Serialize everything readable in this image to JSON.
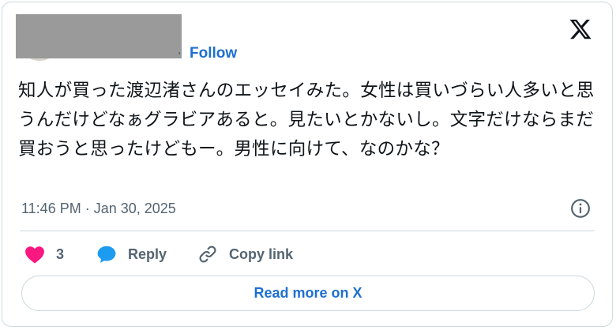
{
  "author": {
    "follow_label": "Follow",
    "separator": "·"
  },
  "tweet": {
    "text": "知人が買った渡辺渚さんのエッセイみた。女性は買いづらい人多いと思うんだけどなぁグラビアあると。見たいとかないし。文字だけならまだ買おうと思ったけどもー。男性に向けて、なのかな？",
    "timestamp": "11:46 PM · Jan 30, 2025"
  },
  "actions": {
    "like_count": "3",
    "reply_label": "Reply",
    "copy_label": "Copy link"
  },
  "read_more_label": "Read more on X",
  "colors": {
    "like": "#f91880",
    "reply": "#1d9bf0",
    "follow": "#1d6fd1",
    "border": "#cfd9de"
  }
}
